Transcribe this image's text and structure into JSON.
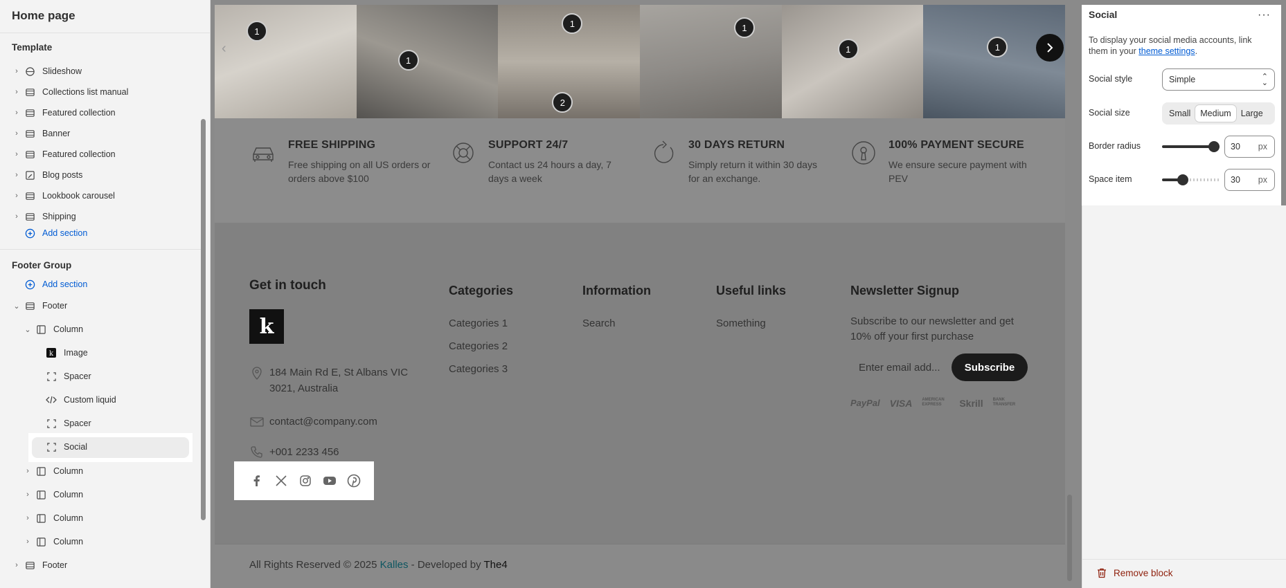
{
  "left_panel": {
    "title": "Home page",
    "template_label": "Template",
    "template_items": [
      "Slideshow",
      "Collections list manual",
      "Featured collection",
      "Banner",
      "Featured collection",
      "Blog posts",
      "Lookbook carousel",
      "Shipping"
    ],
    "add_section": "Add section",
    "footer_group_label": "Footer Group",
    "footer_add_section": "Add section",
    "footer": {
      "label": "Footer",
      "column": "Column",
      "blocks": [
        "Image",
        "Spacer",
        "Custom liquid",
        "Spacer",
        "Social"
      ],
      "columns": [
        "Column",
        "Column",
        "Column",
        "Column"
      ],
      "footer_bottom": "Footer"
    }
  },
  "preview": {
    "pins": [
      "1",
      "1",
      "1",
      "2",
      "1",
      "1",
      "1",
      "1"
    ],
    "features": [
      {
        "title": "FREE SHIPPING",
        "text": "Free shipping on all US orders or orders above $100",
        "icon": "car-icon"
      },
      {
        "title": "SUPPORT 24/7",
        "text": "Contact us 24 hours a day, 7 days a week",
        "icon": "lifebuoy-icon"
      },
      {
        "title": "30 DAYS RETURN",
        "text": "Simply return it within 30 days for an exchange.",
        "icon": "return-arrow-icon"
      },
      {
        "title": "100% PAYMENT SECURE",
        "text": "We ensure secure payment with PEV",
        "icon": "secure-lock-icon"
      }
    ],
    "footer": {
      "get_in_touch": "Get in touch",
      "logo_letter": "k",
      "address": "184 Main Rd E, St Albans VIC 3021, Australia",
      "email": "contact@company.com",
      "phone": "+001 2233 456",
      "categories_title": "Categories",
      "categories": [
        "Categories 1",
        "Categories 2",
        "Categories 3"
      ],
      "information_title": "Information",
      "information": [
        "Search"
      ],
      "useful_title": "Useful links",
      "useful": [
        "Something"
      ],
      "newsletter_title": "Newsletter Signup",
      "newsletter_text": "Subscribe to our newsletter and get 10% off your first purchase",
      "email_placeholder": "Enter email add...",
      "subscribe": "Subscribe",
      "payments": [
        "PayPal",
        "VISA",
        "AMERICAN EXPRESS",
        "Skrill",
        "BANK TRANSFER"
      ]
    },
    "copyright": {
      "prefix": "All Rights Reserved © 2025 ",
      "brand": "Kalles",
      "middle": " - Developed by ",
      "dev": "The4"
    }
  },
  "right_panel": {
    "title": "Social",
    "desc_prefix": "To display your social media accounts, link them in your ",
    "desc_link": "theme settings",
    "desc_suffix": ".",
    "social_style_label": "Social style",
    "social_style_value": "Simple",
    "social_size_label": "Social size",
    "size_options": [
      "Small",
      "Medium",
      "Large"
    ],
    "size_selected": "Medium",
    "border_radius_label": "Border radius",
    "border_radius_value": "30",
    "border_radius_fraction": 1.0,
    "space_item_label": "Space item",
    "space_item_value": "30",
    "space_item_fraction": 0.33,
    "unit": "px",
    "remove_block": "Remove block"
  }
}
